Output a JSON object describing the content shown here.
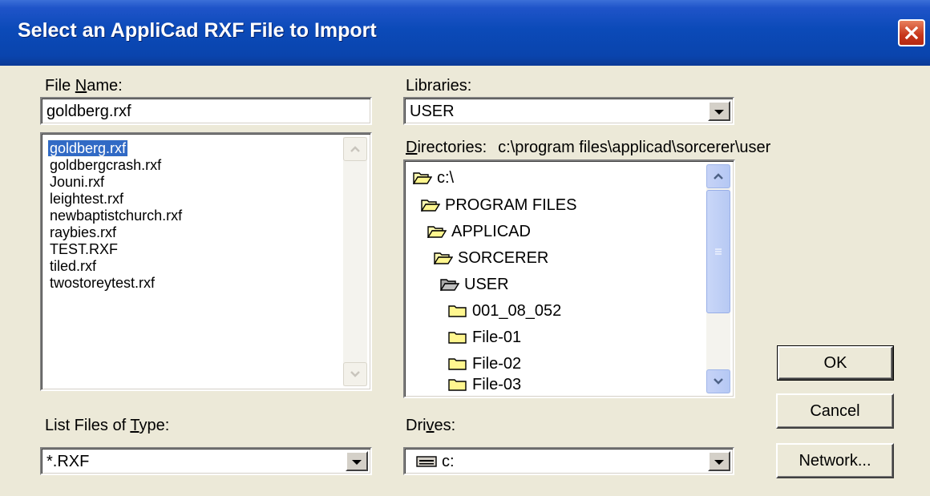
{
  "window": {
    "title": "Select an AppliCad RXF File to Import"
  },
  "file_name": {
    "label_pre": "File ",
    "label_ul": "N",
    "label_post": "ame:",
    "value": "goldberg.rxf"
  },
  "file_list": {
    "items": [
      "goldberg.rxf",
      "goldbergcrash.rxf",
      "Jouni.rxf",
      "leightest.rxf",
      "newbaptistchurch.rxf",
      "raybies.rxf",
      "TEST.RXF",
      "tiled.rxf",
      "twostoreytest.rxf"
    ],
    "selected": "goldberg.rxf"
  },
  "libraries": {
    "label": "Libraries:",
    "value": "USER"
  },
  "directories": {
    "label_ul": "D",
    "label_post": "irectories:",
    "path": "c:\\program files\\applicad\\sorcerer\\user",
    "items": [
      {
        "name": "c:\\",
        "icon": "open-folder-icon"
      },
      {
        "name": "PROGRAM FILES",
        "icon": "open-folder-icon"
      },
      {
        "name": "APPLICAD",
        "icon": "open-folder-icon"
      },
      {
        "name": "SORCERER",
        "icon": "open-folder-icon"
      },
      {
        "name": "USER",
        "icon": "open-folder-current-icon"
      },
      {
        "name": "001_08_052",
        "icon": "folder-icon"
      },
      {
        "name": "File-01",
        "icon": "folder-icon"
      },
      {
        "name": "File-02",
        "icon": "folder-icon"
      },
      {
        "name": "File-03",
        "icon": "folder-icon"
      }
    ]
  },
  "file_type": {
    "label_pre": "List Files of ",
    "label_ul": "T",
    "label_post": "ype:",
    "value": "*.RXF"
  },
  "drives": {
    "label_pre": "Dri",
    "label_ul": "v",
    "label_post": "es:",
    "value": "c:",
    "icon": "drive-icon"
  },
  "buttons": {
    "ok": "OK",
    "cancel": "Cancel",
    "network": "Network..."
  },
  "colors": {
    "titlebar": "#0a44ad",
    "dialog": "#ece9d8",
    "selection": "#316ac5",
    "close": "#c7361a"
  }
}
